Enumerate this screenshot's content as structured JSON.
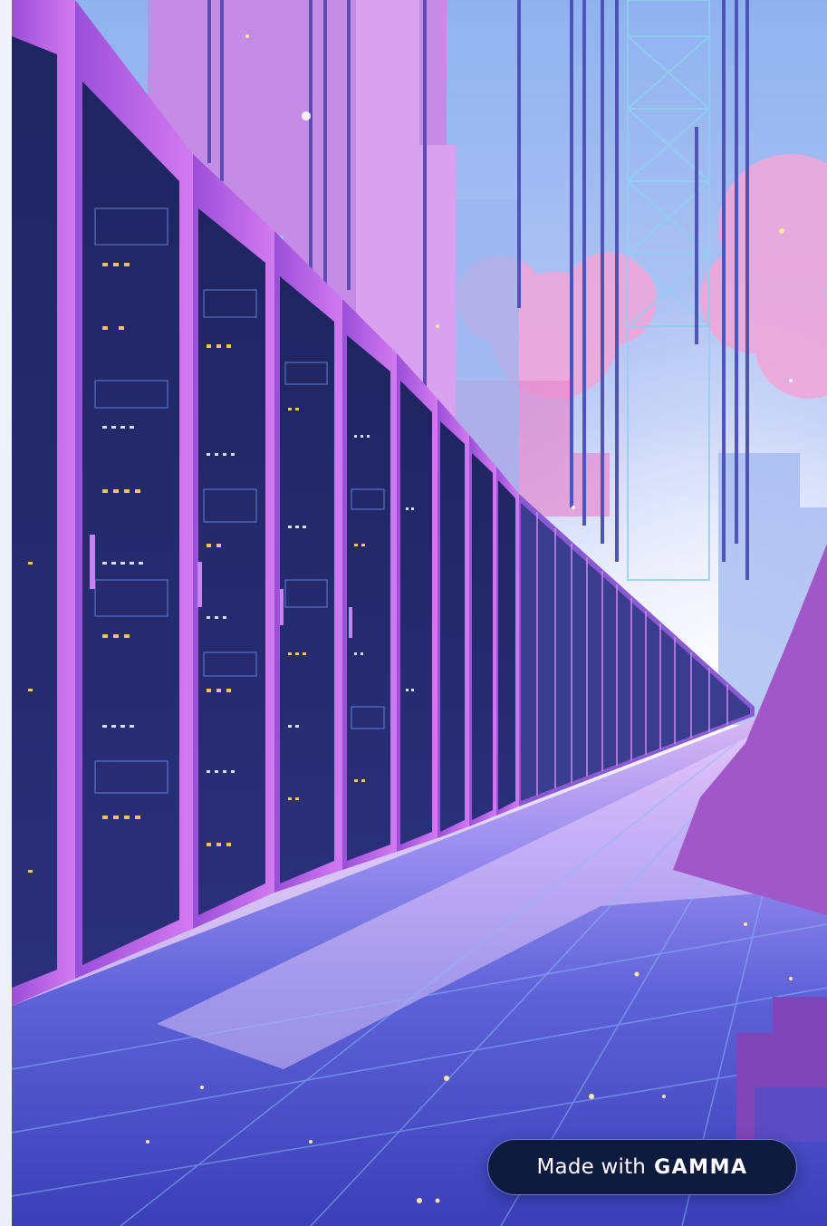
{
  "artwork": {
    "icon": "server-room-illustration-icon"
  },
  "badge": {
    "prefix": "Made with",
    "brand": "GAMMA"
  },
  "colors": {
    "page_background": "#eef0fb",
    "badge_background": "#0f1a3f",
    "badge_border": "#6b7bd4",
    "badge_text": "#ffffff"
  }
}
